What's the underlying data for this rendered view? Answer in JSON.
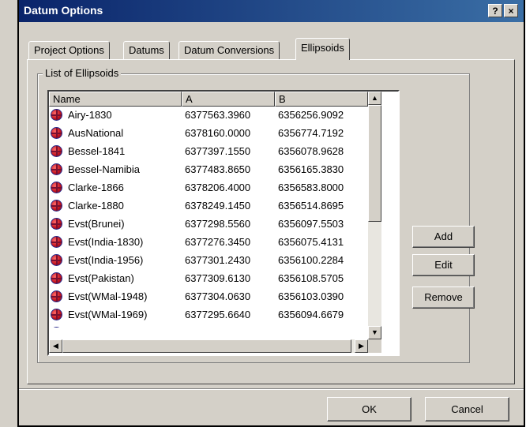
{
  "window": {
    "title": "Datum Options",
    "help_label": "?",
    "close_label": "×"
  },
  "tabs": [
    {
      "label": "Project Options"
    },
    {
      "label": "Datums"
    },
    {
      "label": "Datum Conversions"
    },
    {
      "label": "Ellipsoids",
      "active": true
    }
  ],
  "group": {
    "label": "List of Ellipsoids"
  },
  "list": {
    "columns": [
      "Name",
      "A",
      "B"
    ],
    "rows": [
      {
        "name": "Airy-1830",
        "a": "6377563.3960",
        "b": "6356256.9092"
      },
      {
        "name": "AusNational",
        "a": "6378160.0000",
        "b": "6356774.7192"
      },
      {
        "name": "Bessel-1841",
        "a": "6377397.1550",
        "b": "6356078.9628"
      },
      {
        "name": "Bessel-Namibia",
        "a": "6377483.8650",
        "b": "6356165.3830"
      },
      {
        "name": "Clarke-1866",
        "a": "6378206.4000",
        "b": "6356583.8000"
      },
      {
        "name": "Clarke-1880",
        "a": "6378249.1450",
        "b": "6356514.8695"
      },
      {
        "name": "Evst(Brunei)",
        "a": "6377298.5560",
        "b": "6356097.5503"
      },
      {
        "name": "Evst(India-1830)",
        "a": "6377276.3450",
        "b": "6356075.4131"
      },
      {
        "name": "Evst(India-1956)",
        "a": "6377301.2430",
        "b": "6356100.2284"
      },
      {
        "name": "Evst(Pakistan)",
        "a": "6377309.6130",
        "b": "6356108.5705"
      },
      {
        "name": "Evst(WMal-1948)",
        "a": "6377304.0630",
        "b": "6356103.0390"
      },
      {
        "name": "Evst(WMal-1969)",
        "a": "6377295.6640",
        "b": "6356094.6679"
      }
    ],
    "row_icon": "globe-icon"
  },
  "scroll": {
    "up_arrow": "▲",
    "down_arrow": "▼",
    "left_arrow": "◀",
    "right_arrow": "▶"
  },
  "actions": {
    "add": "Add",
    "edit": "Edit",
    "remove": "Remove"
  },
  "footer": {
    "ok": "OK",
    "cancel": "Cancel"
  },
  "colors": {
    "face": "#d4d0c8",
    "title_start": "#0a246a",
    "title_end": "#3a6ea5",
    "globe": "#c0101a"
  }
}
